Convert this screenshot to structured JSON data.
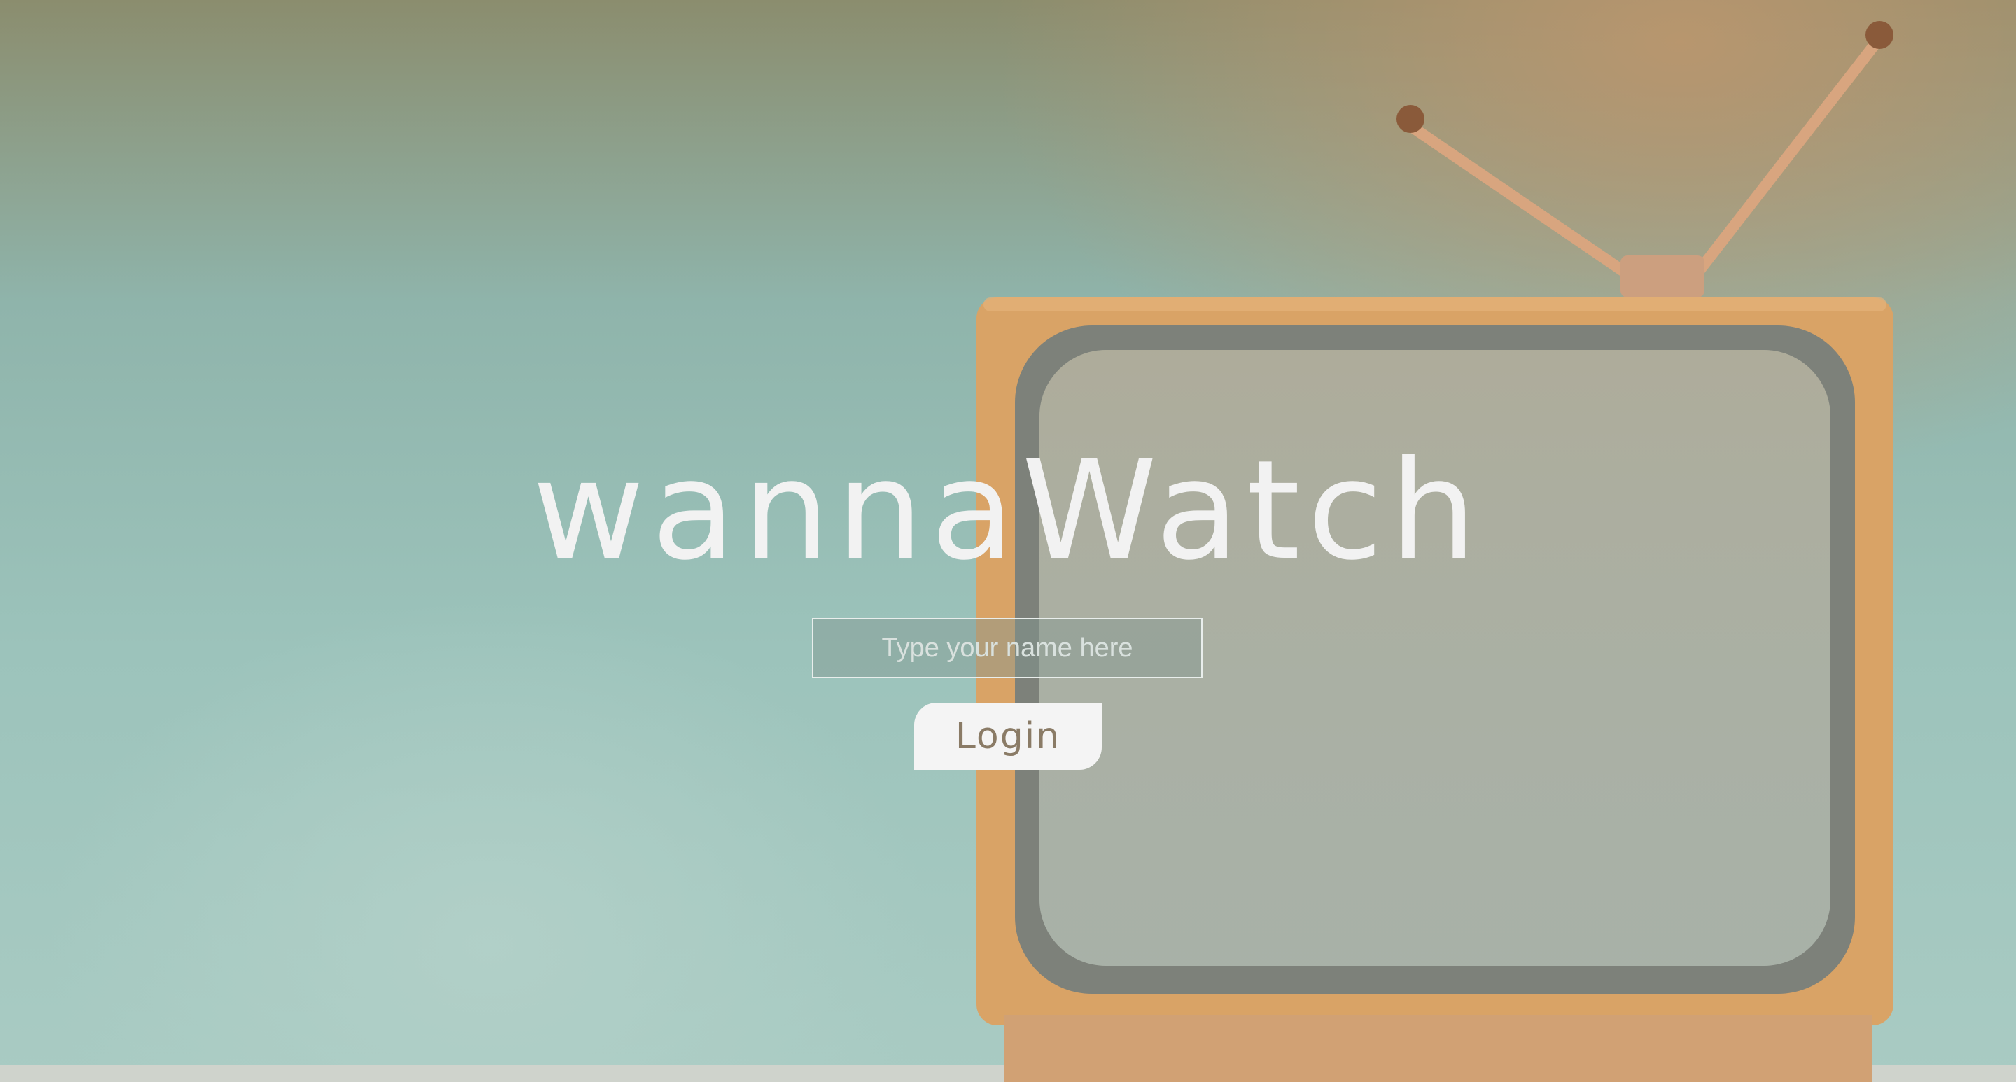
{
  "app": {
    "title": "wannaWatch"
  },
  "login_form": {
    "name_placeholder": "Type your name here",
    "name_value": "",
    "login_label": "Login"
  },
  "colors": {
    "title_text": "#f2f2f2",
    "button_bg": "#f4f4f4",
    "button_text": "#8a7b66",
    "background_teal": "#9cc3bb",
    "tv_body": "#d9a366"
  },
  "background": {
    "illustration": "retro-tv"
  }
}
